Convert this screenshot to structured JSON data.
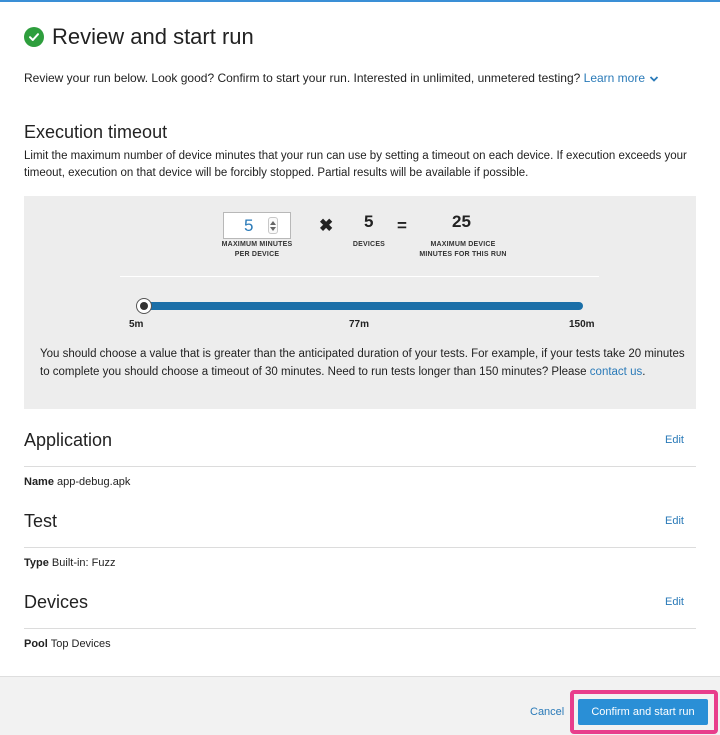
{
  "header": {
    "title": "Review and start run",
    "icon": "check-circle-icon",
    "icon_color": "#2e9e3d"
  },
  "intro": {
    "text": "Review your run below. Look good? Confirm to start your run. Interested in unlimited, unmetered testing?",
    "learn_more": "Learn more"
  },
  "execution_timeout": {
    "title": "Execution timeout",
    "description": "Limit the maximum number of device minutes that your run can use by setting a timeout on each device. If execution exceeds your timeout, execution on that device will be forcibly stopped. Partial results will be available if possible.",
    "minutes_value": "5",
    "minutes_label": "MAXIMUM MINUTES PER DEVICE",
    "times_symbol": "✖",
    "devices_value": "5",
    "devices_label": "DEVICES",
    "equals_symbol": "=",
    "total_value": "25",
    "total_label": "MAXIMUM DEVICE MINUTES FOR THIS RUN",
    "slider": {
      "min_label": "5m",
      "mid_label": "77m",
      "max_label": "150m",
      "level_fraction": 0.0
    },
    "note": "You should choose a value that is greater than the anticipated duration of your tests. For example, if your tests take 20 minutes to complete you should choose a timeout of 30 minutes. Need to run tests longer than 150 minutes? Please",
    "contact_link": "contact us",
    "note_end": "."
  },
  "sections": [
    {
      "title": "Application",
      "edit": "Edit",
      "key": "Name",
      "value": "app-debug.apk"
    },
    {
      "title": "Test",
      "edit": "Edit",
      "key": "Type",
      "value": "Built-in: Fuzz"
    },
    {
      "title": "Devices",
      "edit": "Edit",
      "key": "Pool",
      "value": "Top Devices"
    }
  ],
  "footer": {
    "cancel": "Cancel",
    "confirm": "Confirm and start run"
  },
  "colors": {
    "accent": "#2a7ab8",
    "button": "#2a8fd6",
    "highlight": "#e83e8c",
    "slider": "#1b6fa8"
  }
}
